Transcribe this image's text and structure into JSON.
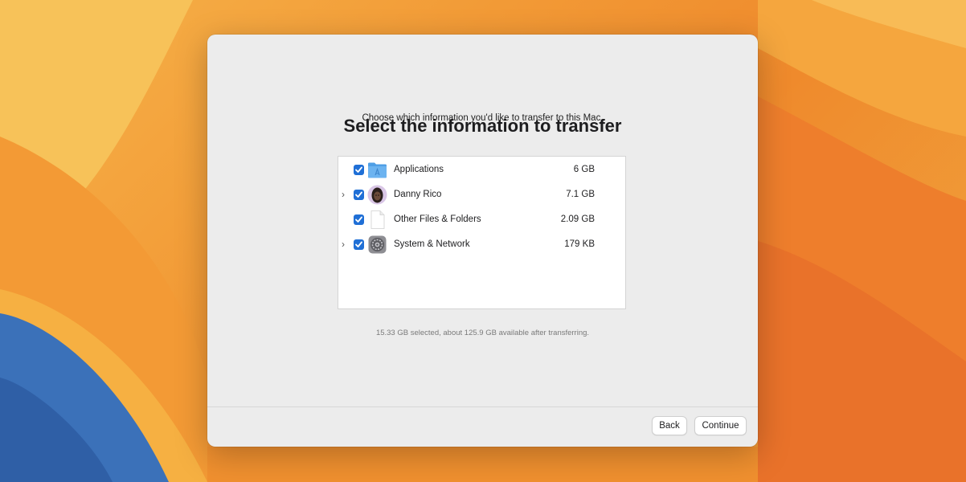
{
  "dialog": {
    "title": "Select the information to transfer",
    "subtitle": "Choose which information you'd like to transfer to this Mac.",
    "summary": "15.33 GB selected, about 125.9 GB available after transferring."
  },
  "items": [
    {
      "label": "Applications",
      "size": "6 GB",
      "checked": true,
      "expandable": false,
      "icon": "applications-folder-icon"
    },
    {
      "label": "Danny Rico",
      "size": "7.1 GB",
      "checked": true,
      "expandable": true,
      "icon": "user-avatar-icon"
    },
    {
      "label": "Other Files & Folders",
      "size": "2.09 GB",
      "checked": true,
      "expandable": false,
      "icon": "document-icon"
    },
    {
      "label": "System & Network",
      "size": "179 KB",
      "checked": true,
      "expandable": true,
      "icon": "system-settings-icon"
    }
  ],
  "buttons": {
    "back": "Back",
    "continue": "Continue"
  },
  "colors": {
    "accent": "#1f6fd6",
    "dialog_bg": "#ececec"
  }
}
